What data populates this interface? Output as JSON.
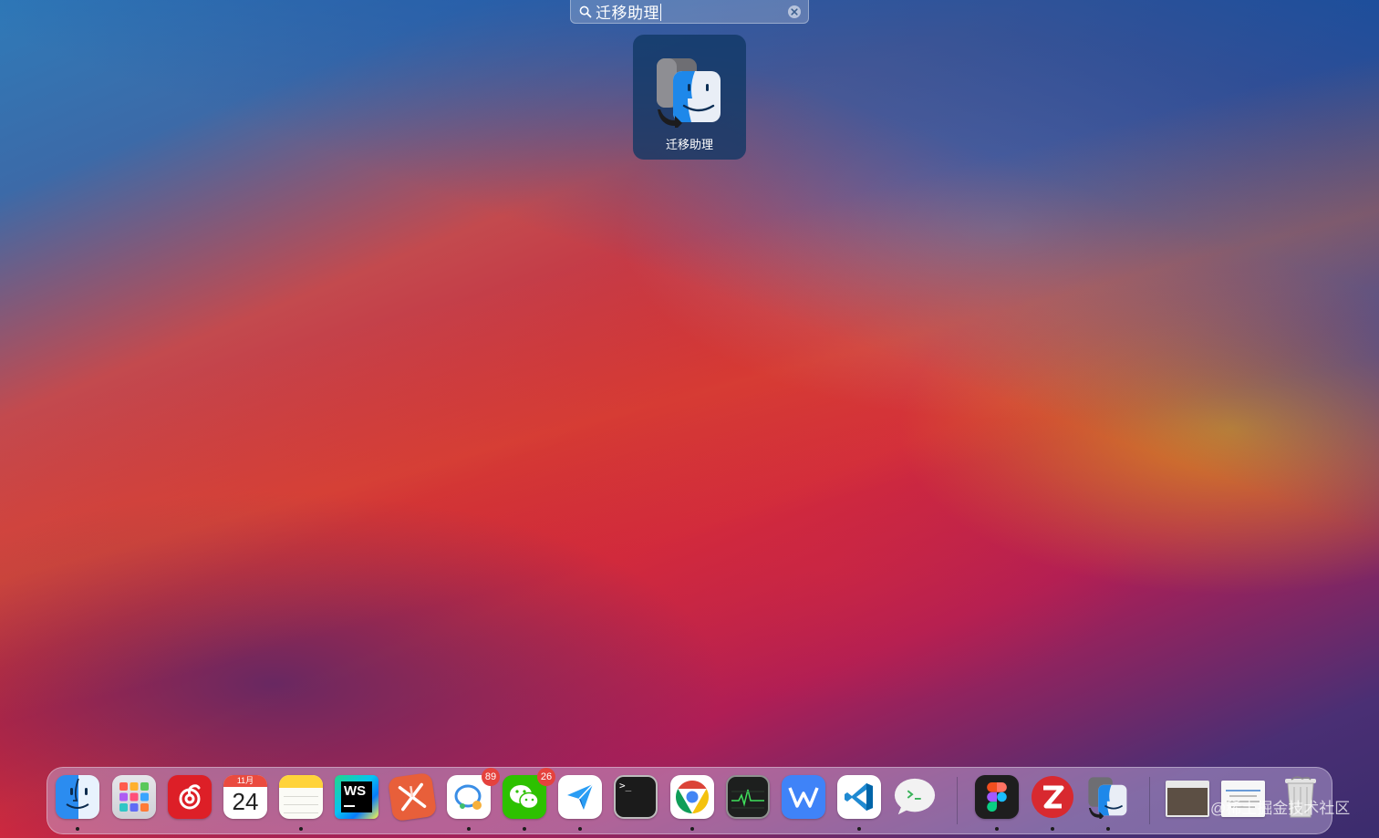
{
  "search": {
    "query": "迁移助理",
    "icon": "magnifier-icon",
    "clear_icon": "clear-icon"
  },
  "result": {
    "label": "迁移助理",
    "icon": "migration-assistant-icon"
  },
  "dock": {
    "apps": [
      {
        "name": "finder",
        "running": true
      },
      {
        "name": "launchpad",
        "running": false
      },
      {
        "name": "netease-music",
        "running": false
      },
      {
        "name": "calendar",
        "month": "11月",
        "day": "24",
        "running": false
      },
      {
        "name": "notes",
        "running": true
      },
      {
        "name": "webstorm",
        "text": "WS",
        "running": false
      },
      {
        "name": "xmind",
        "running": false
      },
      {
        "name": "qq",
        "badge": "89",
        "running": true
      },
      {
        "name": "wechat",
        "badge": "26",
        "running": true
      },
      {
        "name": "feishu",
        "running": true
      },
      {
        "name": "terminal",
        "text": ">_",
        "running": false
      },
      {
        "name": "chrome",
        "running": true
      },
      {
        "name": "activity-monitor",
        "running": false
      },
      {
        "name": "wps",
        "running": false
      },
      {
        "name": "vscode",
        "running": true
      },
      {
        "name": "messages-app",
        "running": false
      },
      {
        "name": "figma",
        "running": true
      },
      {
        "name": "zotero",
        "running": true
      },
      {
        "name": "migration-assistant",
        "running": true
      },
      {
        "name": "downloads-stack",
        "running": false
      },
      {
        "name": "documents-stack",
        "running": false
      },
      {
        "name": "trash",
        "running": false
      }
    ]
  },
  "watermark": "@稀土掘金技术社区",
  "colors": {
    "badge": "#e5423d",
    "result_tile": "#0f3764"
  }
}
